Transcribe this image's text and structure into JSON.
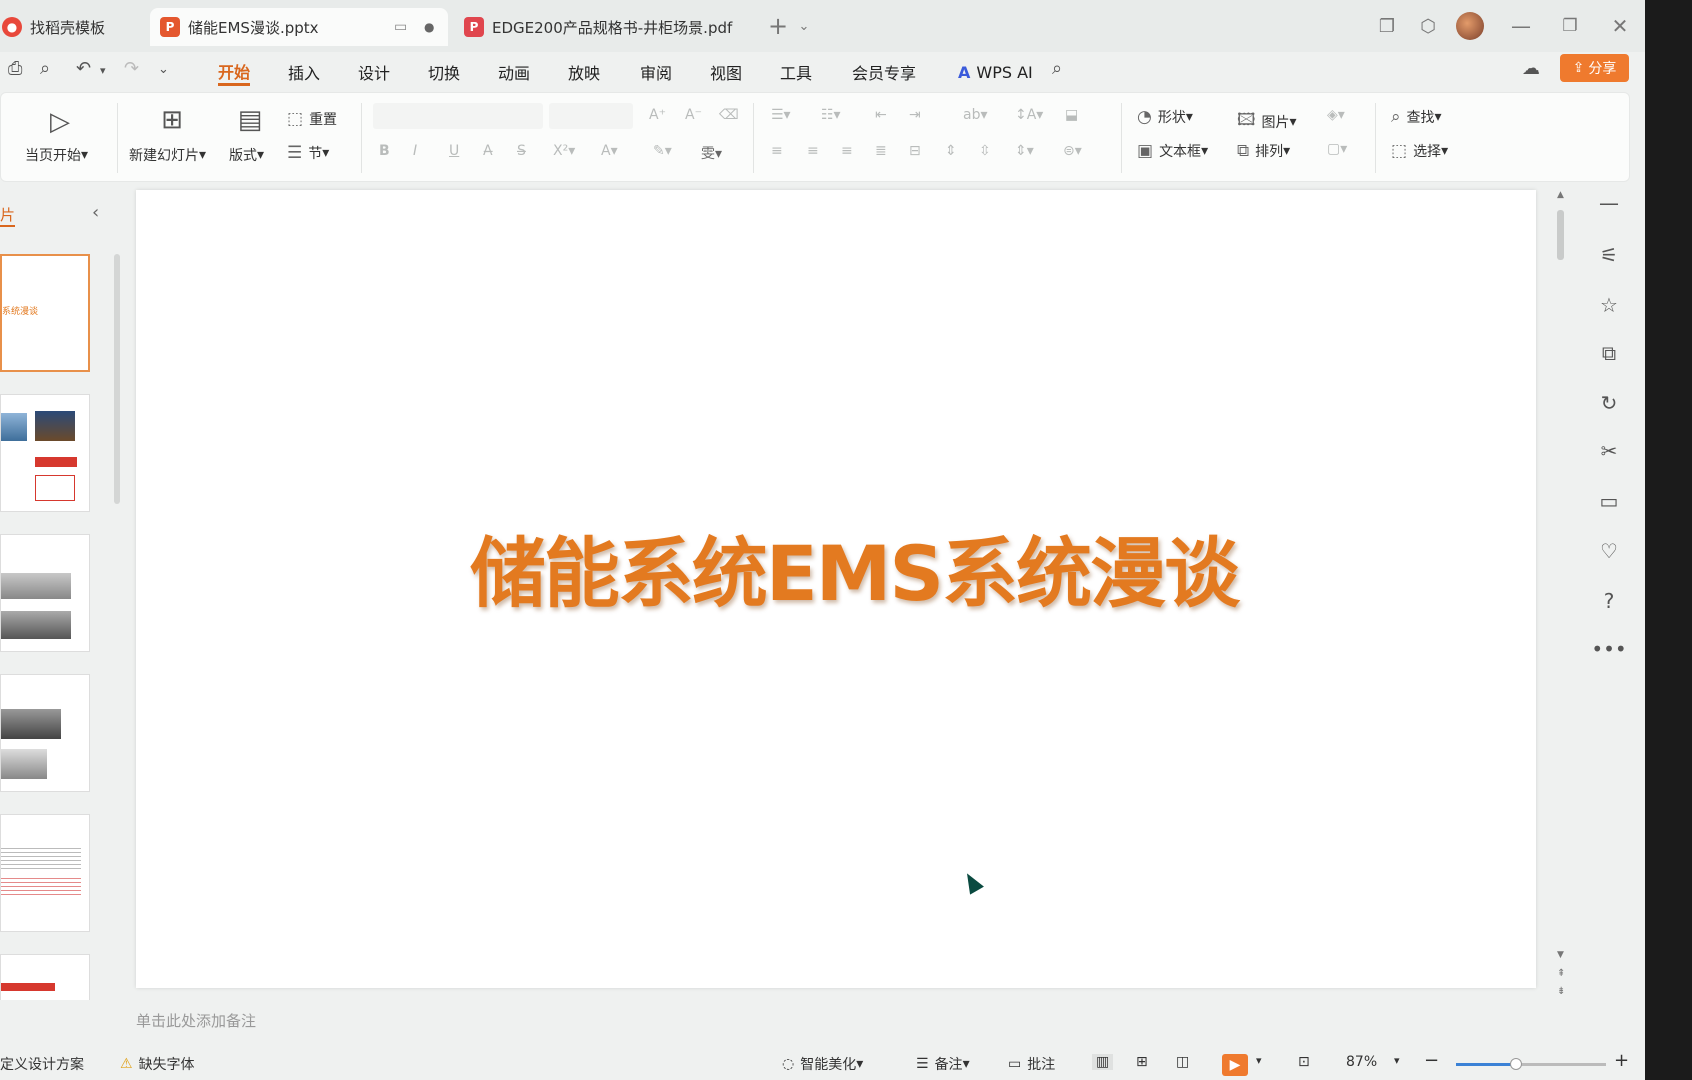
{
  "tabs": [
    {
      "label": "找稻壳模板",
      "icon": "docer-icon",
      "color": "#e8483b"
    },
    {
      "label": "储能EMS漫谈.pptx",
      "icon": "ppt-icon",
      "color": "#e4572e",
      "active": true
    },
    {
      "label": "EDGE200产品规格书-井柜场景.pdf",
      "icon": "pdf-icon",
      "color": "#e0464e"
    }
  ],
  "menu": {
    "items": [
      "开始",
      "插入",
      "设计",
      "切换",
      "动画",
      "放映",
      "审阅",
      "视图",
      "工具",
      "会员专享"
    ],
    "active": "开始",
    "wps_ai": "WPS AI",
    "share": "分享"
  },
  "ribbon": {
    "play_from_current": "当页开始",
    "new_slide": "新建幻灯片",
    "layout": "版式",
    "reset": "重置",
    "section": "节",
    "shape": "形状",
    "picture": "图片",
    "textbox": "文本框",
    "arrange": "排列",
    "find": "查找",
    "select": "选择"
  },
  "panel": {
    "title": "片"
  },
  "thumbs": {
    "t1_text": "系统漫谈"
  },
  "slide": {
    "title": "储能系统EMS系统漫谈"
  },
  "notes_placeholder": "单击此处添加备注",
  "status": {
    "design": "定义设计方案",
    "missing_font": "缺失字体",
    "beautify": "智能美化",
    "notes": "备注",
    "comments": "批注",
    "zoom": "87%"
  },
  "accent": "#e37a20"
}
